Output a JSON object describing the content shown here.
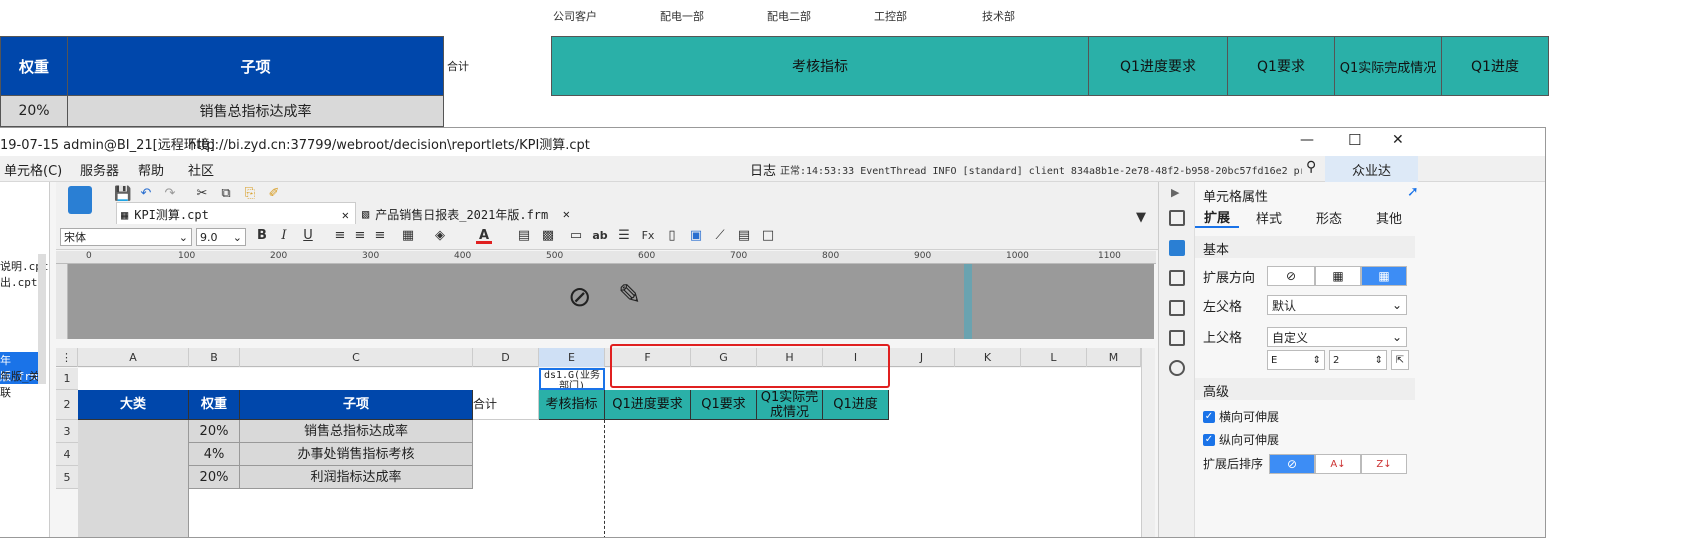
{
  "bg_preview": {
    "departments": [
      "公司客户",
      "配电一部",
      "配电二部",
      "工控部",
      "技术部"
    ],
    "left_headers": [
      "权重",
      "子项"
    ],
    "left_row": [
      "20%",
      "销售总指标达成率"
    ],
    "total_label": "合计",
    "right_headers": [
      "考核指标",
      "Q1进度要求",
      "Q1要求",
      "Q1实际完成情况",
      "Q1进度"
    ]
  },
  "window": {
    "title_left": "19-07-15 admin@BI_21[远程环境]",
    "title_url": "http://bi.zyd.cn:37799/webroot/decision\\reportlets/KPI测算.cpt",
    "controls": [
      "—",
      "☐",
      "✕"
    ]
  },
  "menu": {
    "items": [
      "单元格(C)",
      "服务器",
      "帮助",
      "社区"
    ],
    "log_label": "日志",
    "log_text": "正常:14:53:33 EventThread INFO [standard] client 834a8b1e-2e78-48f2-b958-20bc57fd16e2 prol...",
    "user": "众业达"
  },
  "left_files": [
    "说明.cpt",
    "出.cpt",
    "年版.frm",
    "年版_关联"
  ],
  "tabs": [
    {
      "label": "KPI测算.cpt"
    },
    {
      "label": "产品销售日报表_2021年版.frm"
    }
  ],
  "format": {
    "font": "宋体",
    "size": "9.0"
  },
  "ruler_marks": [
    "0",
    "100",
    "200",
    "300",
    "400",
    "500",
    "600",
    "700",
    "800",
    "900",
    "1000",
    "1100"
  ],
  "columns": [
    "A",
    "B",
    "C",
    "D",
    "E",
    "F",
    "G",
    "H",
    "I",
    "J",
    "K",
    "L",
    "M"
  ],
  "rows": [
    "1",
    "2",
    "3",
    "4",
    "5"
  ],
  "grid": {
    "e1": "ds1.G(业务部门)",
    "header": [
      "大类",
      "权重",
      "子项",
      "合计",
      "考核指标",
      "Q1进度要求",
      "Q1要求",
      "Q1实际完成情况",
      "Q1进度"
    ],
    "r3": [
      "20%",
      "销售总指标达成率"
    ],
    "r4": [
      "4%",
      "办事处销售指标考核"
    ],
    "r5": [
      "20%",
      "利润指标达成率"
    ]
  },
  "props": {
    "title": "单元格属性",
    "tabs": [
      "扩展",
      "样式",
      "形态",
      "其他"
    ],
    "section_basic": "基本",
    "expand_dir": "扩展方向",
    "left_parent": "左父格",
    "left_parent_val": "默认",
    "top_parent": "上父格",
    "top_parent_val": "自定义",
    "top_col": "E",
    "top_row": "2",
    "section_adv": "高级",
    "h_expand": "横向可伸展",
    "v_expand": "纵向可伸展",
    "sort_label": "扩展后排序"
  },
  "colors": {
    "blue": "#0047ab",
    "teal": "#2ab0a8",
    "accent": "#1a73e8",
    "red": "#e02020"
  }
}
